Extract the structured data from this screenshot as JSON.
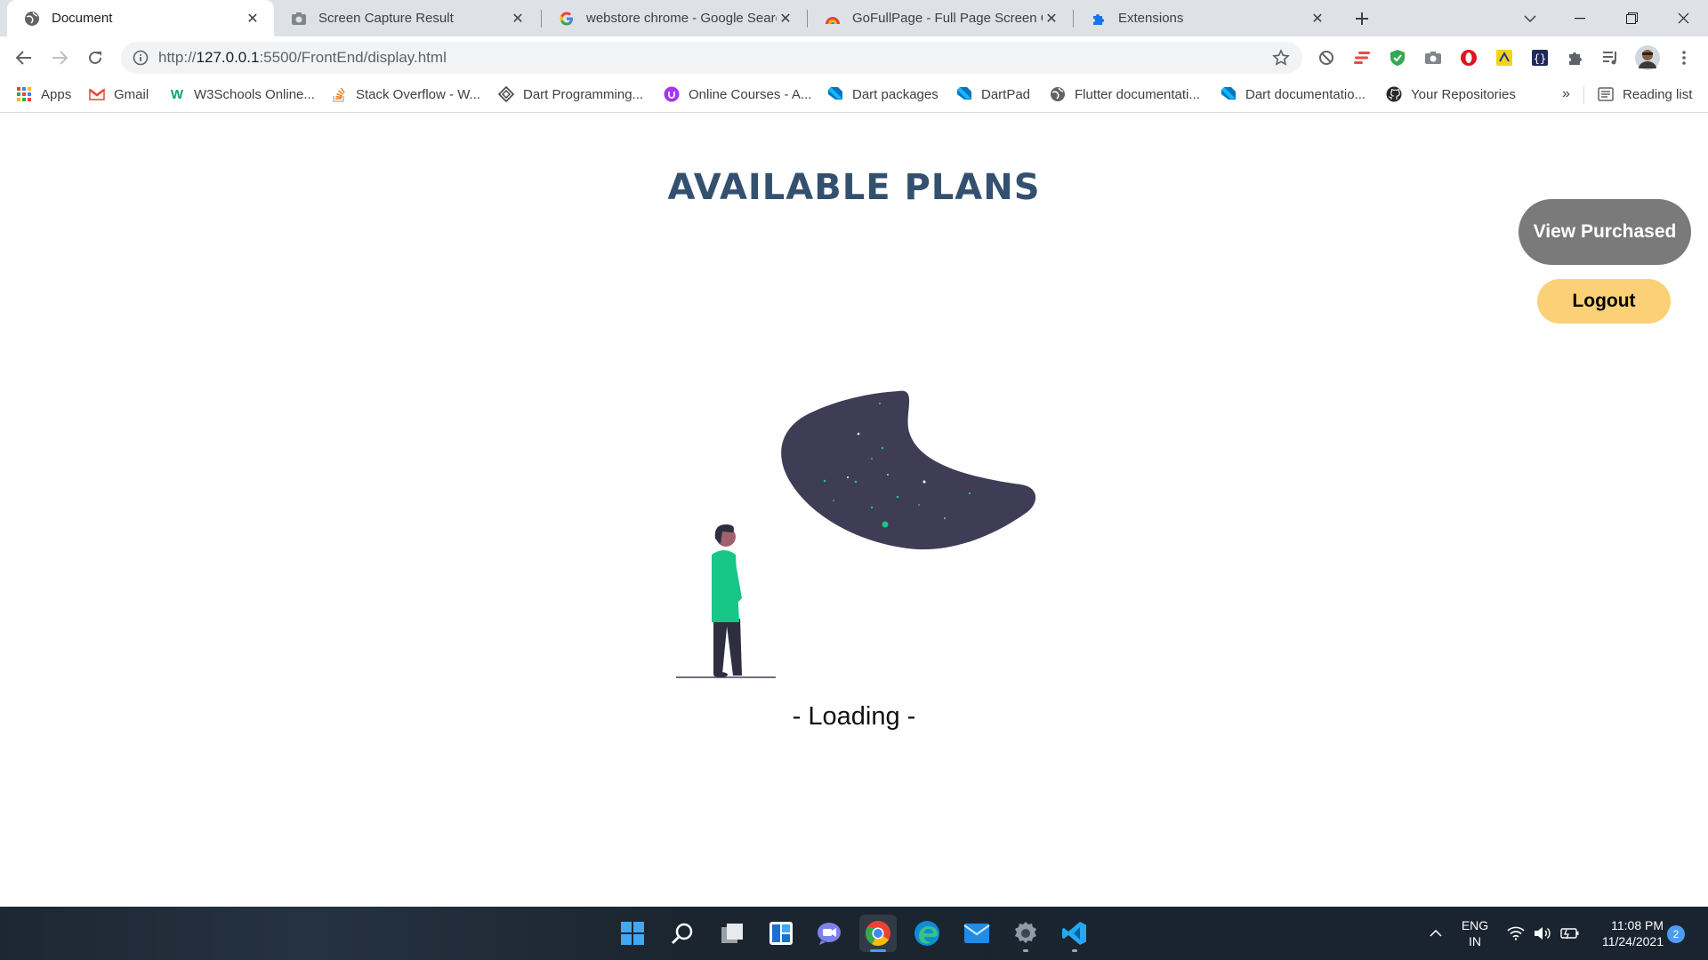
{
  "browser": {
    "tabs": [
      {
        "title": "Document",
        "icon": "globe-icon",
        "active": true
      },
      {
        "title": "Screen Capture Result",
        "icon": "camera-icon",
        "active": false
      },
      {
        "title": "webstore chrome - Google Searc",
        "icon": "google-icon",
        "active": false
      },
      {
        "title": "GoFullPage - Full Page Screen Ca",
        "icon": "gofullpage-icon",
        "active": false
      },
      {
        "title": "Extensions",
        "icon": "puzzle-icon",
        "active": false
      }
    ],
    "new_tab_label": "+",
    "address": {
      "scheme": "http://",
      "host": "127.0.0.1",
      "rest": ":5500/FrontEnd/display.html"
    }
  },
  "bookmarks": [
    {
      "label": "Apps",
      "icon": "apps-grid-icon"
    },
    {
      "label": "Gmail",
      "icon": "gmail-icon"
    },
    {
      "label": "W3Schools Online...",
      "icon": "w3schools-icon"
    },
    {
      "label": "Stack Overflow - W...",
      "icon": "stackoverflow-icon"
    },
    {
      "label": "Dart Programming...",
      "icon": "dart-diamond-icon"
    },
    {
      "label": "Online Courses - A...",
      "icon": "udemy-icon"
    },
    {
      "label": "Dart packages",
      "icon": "dart-icon"
    },
    {
      "label": "DartPad",
      "icon": "dart-icon"
    },
    {
      "label": "Flutter documentati...",
      "icon": "globe-icon"
    },
    {
      "label": "Dart documentatio...",
      "icon": "dart-icon"
    },
    {
      "label": "Your Repositories",
      "icon": "github-icon"
    }
  ],
  "bookmarks_more": "»",
  "reading_list": "Reading list",
  "page": {
    "title": "AVAILABLE PLANS",
    "view_purchased": "View Purchased",
    "logout": "Logout",
    "loading": "- Loading -"
  },
  "colors": {
    "title": "#34506f",
    "view_purchased_bg": "#7a7a7a",
    "logout_bg": "#fcd076",
    "blob": "#3f3d56",
    "accent_green": "#16c787"
  },
  "taskbar": {
    "apps": [
      "windows-start-icon",
      "search-icon",
      "task-view-icon",
      "widgets-icon",
      "teams-chat-icon",
      "chrome-icon",
      "edge-icon",
      "mail-icon",
      "settings-icon",
      "vscode-icon"
    ],
    "lang_line1": "ENG",
    "lang_line2": "IN",
    "time": "11:08 PM",
    "date": "11/24/2021",
    "notifications": "2"
  }
}
